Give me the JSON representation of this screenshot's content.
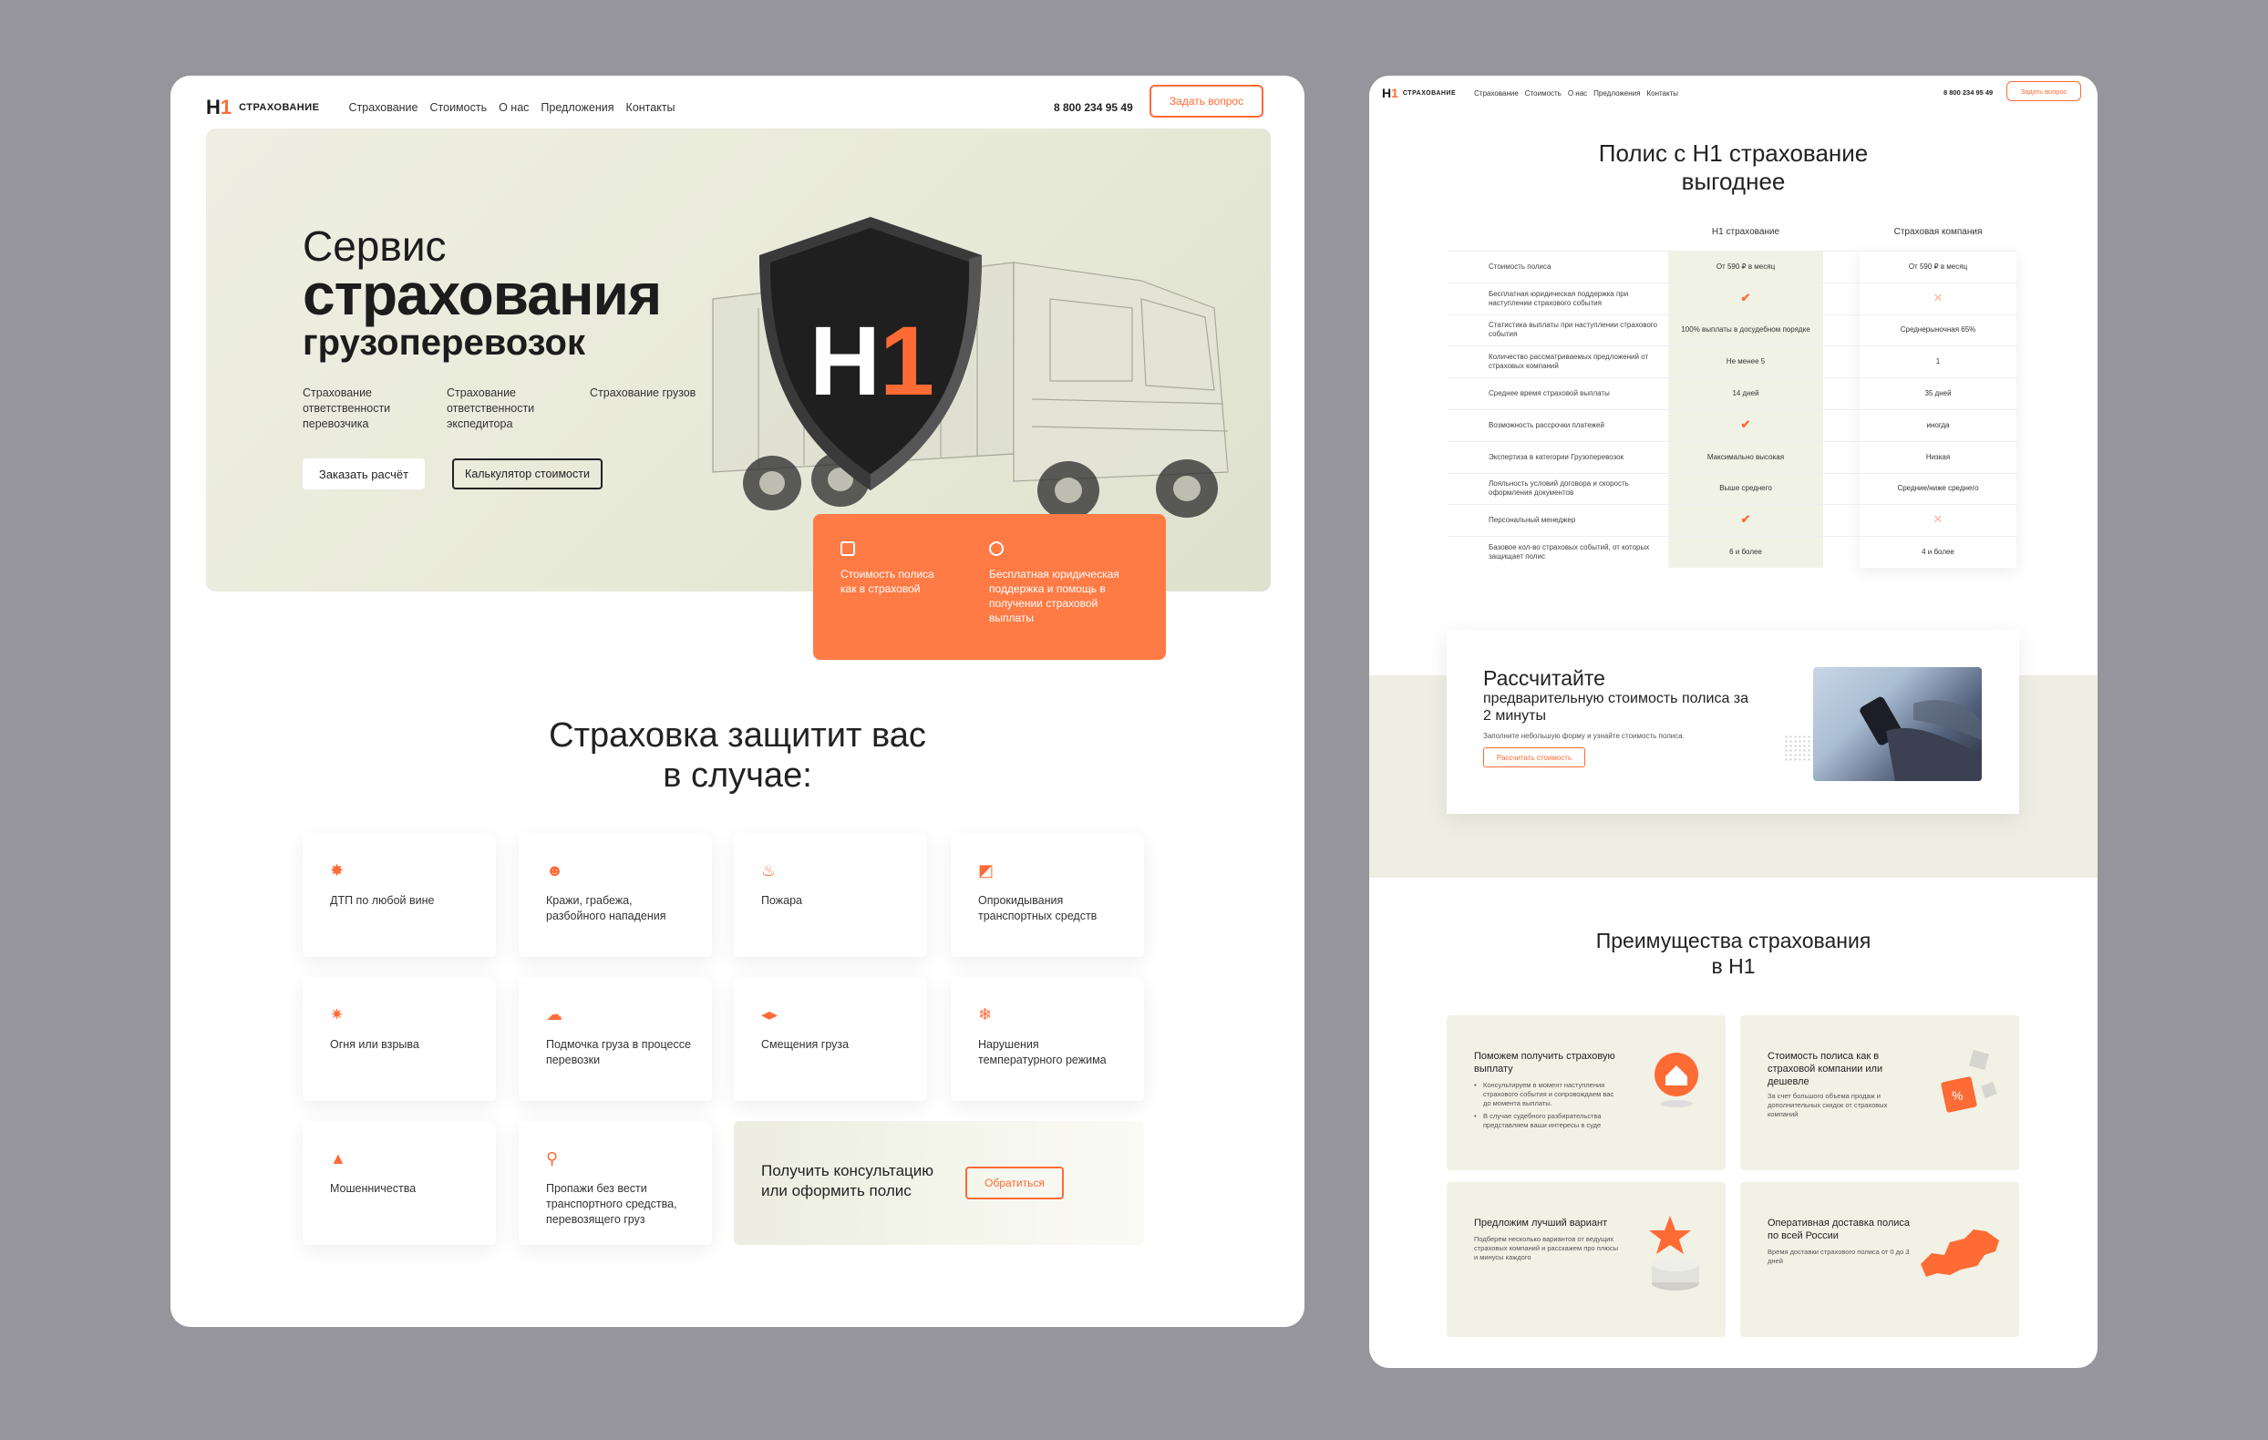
{
  "colors": {
    "accent": "#ff6b35",
    "hero_bg": "#eeefe2",
    "page_bg": "#96959c"
  },
  "brand": {
    "mark_h": "H",
    "mark_1": "1",
    "name": "СТРАХОВАНИЕ"
  },
  "nav": [
    "Страхование",
    "Стоимость",
    "О нас",
    "Предложения",
    "Контакты"
  ],
  "phone": "8 800 234 95 49",
  "ask_button": "Задать вопрос",
  "hero": {
    "title_line1": "Сервис",
    "title_line2": "страхования",
    "title_line3": "грузоперевозок",
    "subs": [
      "Страхование ответственности перевозчика",
      "Страхование ответственности экспедитора",
      "Страхование грузов"
    ],
    "btn_order": "Заказать расчёт",
    "btn_calc": "Калькулятор стоимости",
    "shield_h": "H",
    "shield_1": "1"
  },
  "orange_card": {
    "item1": "Стоимость полиса как в страховой",
    "item2": "Бесплатная юридическая поддержка и помощь в получении страховой выплаты"
  },
  "protect": {
    "title_line1": "Страховка защитит вас",
    "title_line2": "в случае:",
    "items": [
      {
        "icon": "car-crash-icon",
        "label": "ДТП по любой вине"
      },
      {
        "icon": "thief-icon",
        "label": "Кражи, грабежа, разбойного нападения"
      },
      {
        "icon": "fire-icon",
        "label": "Пожара"
      },
      {
        "icon": "truck-overturn-icon",
        "label": "Опрокидывания транспортных средств"
      },
      {
        "icon": "explosion-icon",
        "label": "Огня или взрыва"
      },
      {
        "icon": "rain-cloud-icon",
        "label": "Подмочка груза в процессе перевозки"
      },
      {
        "icon": "shift-arrows-icon",
        "label": "Смещения груза"
      },
      {
        "icon": "temperature-icon",
        "label": "Нарушения температурного режима"
      },
      {
        "icon": "fraud-hat-icon",
        "label": "Мошенничества"
      },
      {
        "icon": "missing-search-icon",
        "label": "Пропажи без вести транспортного средства, перевозящего груз"
      }
    ],
    "consult_text": "Получить консультацию или оформить полис",
    "consult_btn": "Обратиться"
  },
  "compare": {
    "title_line1": "Полис с H1 страхование",
    "title_line2": "выгоднее",
    "col_h1": "H1 страхование",
    "col_other": "Страховая компания",
    "rows": [
      {
        "label": "Стоимость полиса",
        "h1": "От 590 ₽ в месяц",
        "other": "От 590 ₽ в месяц"
      },
      {
        "label": "Бесплатная юридическая поддержка при наступлении страхового события",
        "h1": "check",
        "other": "cross"
      },
      {
        "label": "Статистика выплаты при наступлении страхового события",
        "h1": "100% выплаты в досудебном порядке",
        "other": "Среднерыночная 65%"
      },
      {
        "label": "Количество рассматриваемых предложений от страховых компаний",
        "h1": "Не менее 5",
        "other": "1"
      },
      {
        "label": "Среднее время страховой выплаты",
        "h1": "14 дней",
        "other": "35 дней"
      },
      {
        "label": "Возможность рассрочки платежей",
        "h1": "check",
        "other": "иногда"
      },
      {
        "label": "Экспертиза в категории Грузоперевозок",
        "h1": "Максимально высокая",
        "other": "Низкая"
      },
      {
        "label": "Лояльность условий договора и скорость оформления документов",
        "h1": "Выше среднего",
        "other": "Средние/ниже среднего"
      },
      {
        "label": "Персональный менеджер",
        "h1": "check",
        "other": "cross"
      },
      {
        "label": "Базовое кол-во страховых событий, от которых защищает полис",
        "h1": "6 и более",
        "other": "4 и более"
      }
    ]
  },
  "calc": {
    "title": "Рассчитайте",
    "subtitle": "предварительную стоимость полиса за 2 минуты",
    "hint": "Заполните небольшую форму и узнайте стоимость полиса.",
    "btn": "Рассчитать стоимость"
  },
  "advantages": {
    "title_line1": "Преимущества страхования",
    "title_line2": "в H1",
    "cards": [
      {
        "title": "Поможем получить страховую выплату",
        "bullets": [
          "Консультируем в момент наступления страхового события и сопровождаем вас до момента выплаты.",
          "В случае судебного разбирательства представляем ваши интересы в суде"
        ],
        "icon": "house-badge-icon"
      },
      {
        "title": "Стоимость полиса как в страховой компании или дешевле",
        "desc": "За счет большого объема продаж и дополнительных скидок от страховых компаний",
        "icon": "percent-cubes-icon"
      },
      {
        "title": "Предложим лучший вариант",
        "desc": "Подберем несколько вариантов от ведущих страховых компаний и расскажем про плюсы и минусы каждого",
        "icon": "star-podium-icon"
      },
      {
        "title": "Оперативная доставка полиса по всей России",
        "desc": "Время доставки страхового полиса от 0 до 3 дней",
        "icon": "russia-map-icon"
      }
    ]
  },
  "right_phone": "8 800 234 95 49",
  "right_ask_button": "Задать вопрос"
}
